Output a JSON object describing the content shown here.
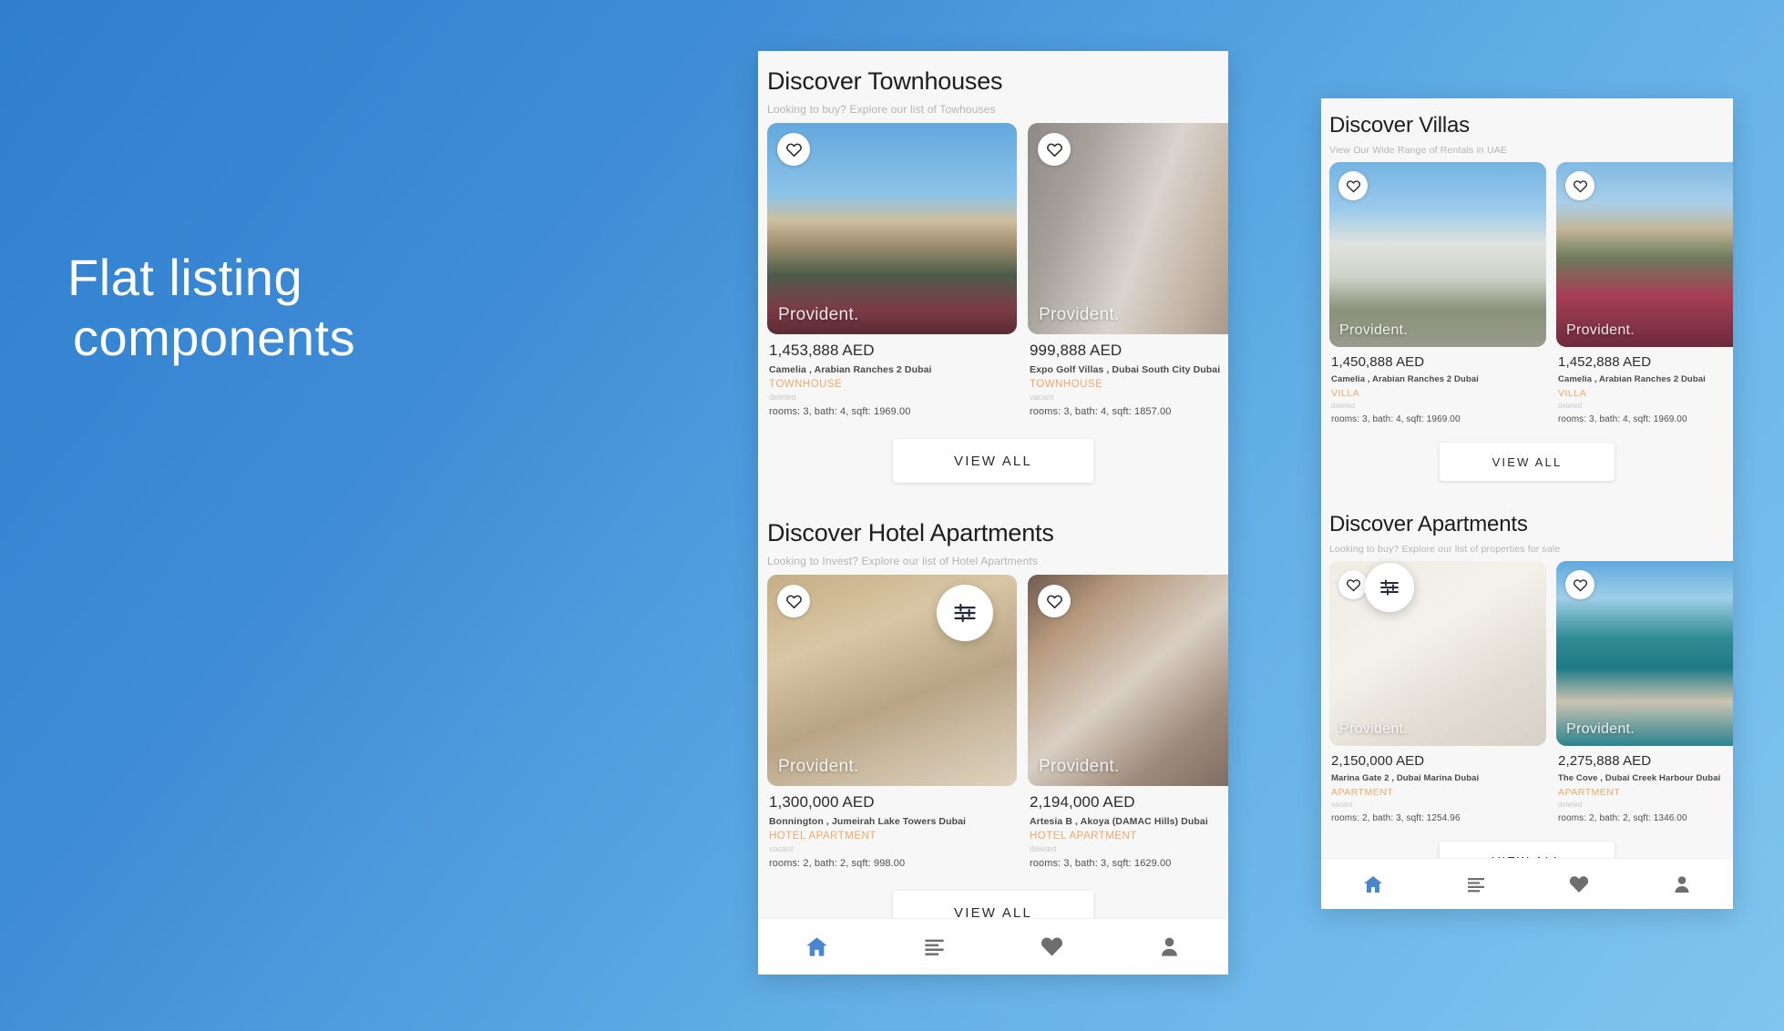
{
  "hero": {
    "line1": "Flat listing",
    "line2": "components"
  },
  "colors": {
    "accent": "#f0a868",
    "nav_active": "#4a86d0",
    "nav_inactive": "#6e6e6e",
    "bg_start": "#2f7fcf",
    "bg_end": "#7fc5ef"
  },
  "labels": {
    "view_all": "VIEW ALL",
    "watermark": "Provident."
  },
  "phone_left": {
    "sections": [
      {
        "title": "Discover Townhouses",
        "subtitle": "Looking to buy? Explore our list of Towhouses",
        "cards": [
          {
            "price": "1,453,888 AED",
            "location": "Camelia , Arabian Ranches 2 Dubai",
            "type": "TOWNHOUSE",
            "status": "deleted",
            "specs": "rooms: 3, bath: 4, sqft: 1969.00",
            "photo": "ph-townhouse"
          },
          {
            "price": "999,888 AED",
            "location": "Expo Golf Villas , Dubai South City Dubai",
            "type": "TOWNHOUSE",
            "status": "vacant",
            "specs": "rooms: 3, bath: 4, sqft: 1857.00",
            "photo": "ph-kitchen"
          }
        ]
      },
      {
        "title": "Discover Hotel Apartments",
        "subtitle": "Looking to Invest? Explore our list of Hotel Apartments",
        "cards": [
          {
            "price": "1,300,000 AED",
            "location": "Bonnington , Jumeirah Lake Towers Dubai",
            "type": "HOTEL APARTMENT",
            "status": "vacant",
            "specs": "rooms: 2, bath: 2, sqft: 998.00",
            "photo": "ph-livingrm"
          },
          {
            "price": "2,194,000 AED",
            "location": "Artesia B , Akoya (DAMAC Hills) Dubai",
            "type": "HOTEL APARTMENT",
            "status": "deleted",
            "specs": "rooms: 3, bath: 3, sqft: 1629.00",
            "photo": "ph-lobby"
          }
        ]
      }
    ],
    "nav": [
      {
        "icon": "home-icon",
        "active": true
      },
      {
        "icon": "list-icon",
        "active": false
      },
      {
        "icon": "heart-icon",
        "active": false
      },
      {
        "icon": "user-icon",
        "active": false
      }
    ]
  },
  "phone_right": {
    "sections": [
      {
        "title": "Discover Villas",
        "subtitle": "View Our Wide Range of Rentals in UAE",
        "cards": [
          {
            "price": "1,450,888 AED",
            "location": "Camelia , Arabian Ranches 2 Dubai",
            "type": "VILLA",
            "status": "deleted",
            "specs": "rooms: 3, bath: 4, sqft: 1969.00",
            "photo": "ph-villa"
          },
          {
            "price": "1,452,888 AED",
            "location": "Camelia , Arabian Ranches 2 Dubai",
            "type": "VILLA",
            "status": "deleted",
            "specs": "rooms: 3, bath: 4, sqft: 1969.00",
            "photo": "ph-flowers"
          }
        ]
      },
      {
        "title": "Discover Apartments",
        "subtitle": "Looking to buy? Explore our list of properties for sale",
        "cards": [
          {
            "price": "2,150,000 AED",
            "location": "Marina Gate 2 , Dubai Marina Dubai",
            "type": "APARTMENT",
            "status": "vacant",
            "specs": "rooms: 2, bath: 3, sqft: 1254.96",
            "photo": "ph-empty"
          },
          {
            "price": "2,275,888 AED",
            "location": "The Cove , Dubai Creek Harbour Dubai",
            "type": "APARTMENT",
            "status": "deleted",
            "specs": "rooms: 2, bath: 2, sqft: 1346.00",
            "photo": "ph-marina"
          }
        ]
      }
    ],
    "nav": [
      {
        "icon": "home-icon",
        "active": true
      },
      {
        "icon": "list-icon",
        "active": false
      },
      {
        "icon": "heart-icon",
        "active": false
      },
      {
        "icon": "user-icon",
        "active": false
      }
    ]
  }
}
